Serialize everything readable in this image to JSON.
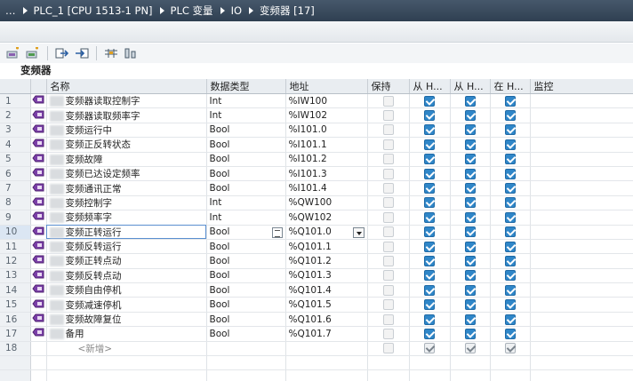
{
  "breadcrumb": [
    "…",
    "PLC_1 [CPU 1513-1 PN]",
    "PLC 变量",
    "IO",
    "变频器 [17]"
  ],
  "table_title": "变频器",
  "columns": {
    "name": "名称",
    "datatype": "数据类型",
    "address": "地址",
    "retain": "保持",
    "from_hmi1": "从 H...",
    "from_hmi2": "从 H...",
    "in_hmi": "在 H...",
    "monitor": "监控"
  },
  "rows": [
    {
      "n": "1",
      "name": "变频器读取控制字",
      "type": "Int",
      "addr": "%IW100"
    },
    {
      "n": "2",
      "name": "变频器读取频率字",
      "type": "Int",
      "addr": "%IW102"
    },
    {
      "n": "3",
      "name": "变频运行中",
      "type": "Bool",
      "addr": "%I101.0"
    },
    {
      "n": "4",
      "name": "变频正反转状态",
      "type": "Bool",
      "addr": "%I101.1"
    },
    {
      "n": "5",
      "name": "变频故障",
      "type": "Bool",
      "addr": "%I101.2"
    },
    {
      "n": "6",
      "name": "变频已达设定频率",
      "type": "Bool",
      "addr": "%I101.3"
    },
    {
      "n": "7",
      "name": "变频通讯正常",
      "type": "Bool",
      "addr": "%I101.4"
    },
    {
      "n": "8",
      "name": "变频控制字",
      "type": "Int",
      "addr": "%QW100"
    },
    {
      "n": "9",
      "name": "变频频率字",
      "type": "Int",
      "addr": "%QW102"
    },
    {
      "n": "10",
      "name": "变频正转运行",
      "type": "Bool",
      "addr": "%Q101.0"
    },
    {
      "n": "11",
      "name": "变频反转运行",
      "type": "Bool",
      "addr": "%Q101.1"
    },
    {
      "n": "12",
      "name": "变频正转点动",
      "type": "Bool",
      "addr": "%Q101.2"
    },
    {
      "n": "13",
      "name": "变频反转点动",
      "type": "Bool",
      "addr": "%Q101.3"
    },
    {
      "n": "14",
      "name": "变频自由停机",
      "type": "Bool",
      "addr": "%Q101.4"
    },
    {
      "n": "15",
      "name": "变频减速停机",
      "type": "Bool",
      "addr": "%Q101.5"
    },
    {
      "n": "16",
      "name": "变频故障复位",
      "type": "Bool",
      "addr": "%Q101.6"
    },
    {
      "n": "17",
      "name": "备用",
      "type": "Bool",
      "addr": "%Q101.7"
    }
  ],
  "new_row": {
    "n": "18",
    "name": "<新增>"
  },
  "selected_row": "10",
  "icons": [
    "add-tag-icon",
    "add-group-icon",
    "export-icon",
    "import-icon",
    "monitor-icon",
    "settings-icon",
    "tag-icon"
  ],
  "colors": {
    "accent": "#2f86c8",
    "titlebar": "#3a4b5e"
  }
}
